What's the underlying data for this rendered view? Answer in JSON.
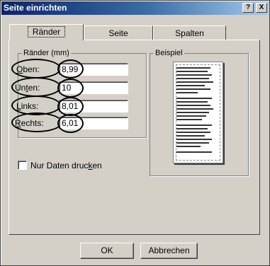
{
  "window": {
    "title": "Seite einrichten",
    "help_label": "?",
    "close_label": "X"
  },
  "tabs": [
    {
      "label": "Ränder"
    },
    {
      "label": "Seite"
    },
    {
      "label": "Spalten"
    }
  ],
  "margins": {
    "group_label": "Ränder (mm)",
    "fields": [
      {
        "label_pre": "",
        "label_access": "O",
        "label_post": "ben:",
        "value": "8,99"
      },
      {
        "label_pre": "Un",
        "label_access": "t",
        "label_post": "en:",
        "value": "10"
      },
      {
        "label_pre": "",
        "label_access": "L",
        "label_post": "inks:",
        "value": "8,01"
      },
      {
        "label_pre": "",
        "label_access": "R",
        "label_post": "echts:",
        "value": "6,01"
      }
    ]
  },
  "preview": {
    "group_label": "Beispiel"
  },
  "options": {
    "print_data_only_pre": "Nur Daten druc",
    "print_data_only_access": "k",
    "print_data_only_post": "en",
    "checked": false
  },
  "buttons": {
    "ok": "OK",
    "cancel": "Abbrechen"
  }
}
